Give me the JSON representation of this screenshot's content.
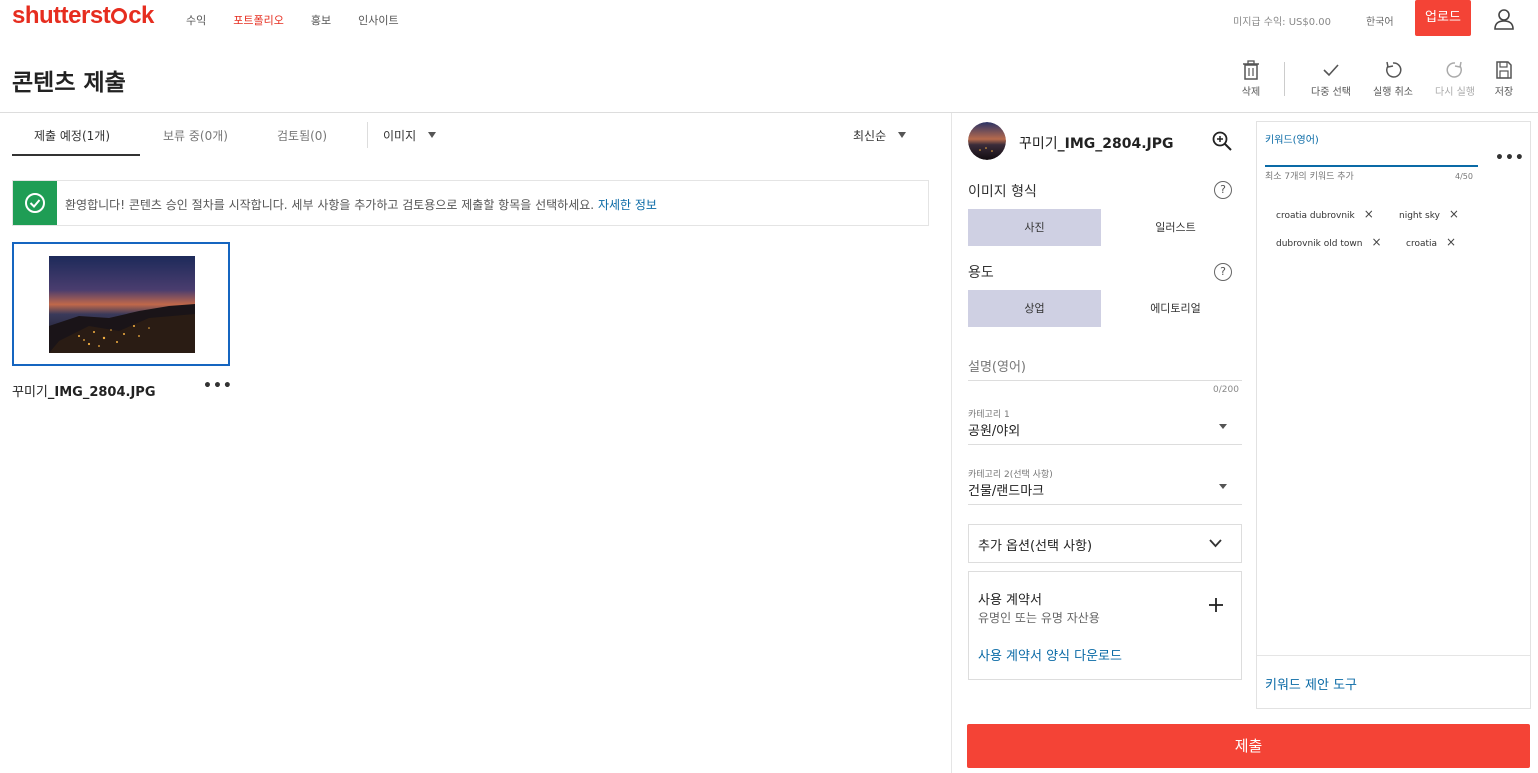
{
  "nav": {
    "logo": "shutterstock",
    "logo_parts": [
      "shutterst",
      "ck"
    ],
    "links": [
      "수익",
      "포트폴리오",
      "홍보",
      "인사이트"
    ],
    "active_link": "포트폴리오",
    "earnings": "미지급 수익: US$0.00",
    "language": "한국어",
    "upload": "업로드"
  },
  "page": {
    "title": "콘텐츠 제출"
  },
  "toolbar": {
    "delete": "삭제",
    "multi_select": "다중 선택",
    "undo": "실행 취소",
    "redo": "다시 실행",
    "save": "저장"
  },
  "tabs": {
    "to_submit": "제출 예정(1개)",
    "pending": "보류 중(0개)",
    "reviewed": "검토됨(0)",
    "filter": "이미지",
    "sort": "최신순"
  },
  "banner": {
    "message": "환영합니다! 콘텐츠 승인 절차를 시작합니다. 세부 사항을 추가하고 검토용으로 제출할 항목을 선택하세요.",
    "link": "자세한 정보"
  },
  "file": {
    "name_prefix": "꾸미기",
    "name_suffix": "_IMG_2804.JPG",
    "more": "•••"
  },
  "details": {
    "image_type_label": "이미지 형식",
    "image_type_options": [
      "사진",
      "일러스트"
    ],
    "image_type_selected": "사진",
    "usage_label": "용도",
    "usage_options": [
      "상업",
      "에디토리얼"
    ],
    "usage_selected": "상업",
    "description_label": "설명(영어)",
    "description_counter": "0/200",
    "category1_label": "카테고리 1",
    "category1_value": "공원/야외",
    "category2_label": "카테고리 2(선택 사항)",
    "category2_value": "건물/랜드마크",
    "extra_options": "추가 옵션(선택 사항)",
    "release_title": "사용 계약서",
    "release_sub": "유명인 또는 유명 자산용",
    "release_link": "사용 계약서 양식 다운로드",
    "help_glyph": "?"
  },
  "keywords": {
    "title": "키워드(영어)",
    "hint": "최소 7개의 키워드 추가",
    "count": "4/50",
    "more": "•••",
    "chips": [
      "croatia dubrovnik",
      "night sky",
      "dubrovnik old town",
      "croatia"
    ],
    "remove_glyph": "×",
    "tool_link": "키워드 제안 도구"
  },
  "submit": "제출",
  "colors": {
    "brand": "#e62d1f",
    "button": "#f44336",
    "link": "#0a6aa6",
    "success": "#1f9d55",
    "selected_segment": "#cfd0e3"
  }
}
